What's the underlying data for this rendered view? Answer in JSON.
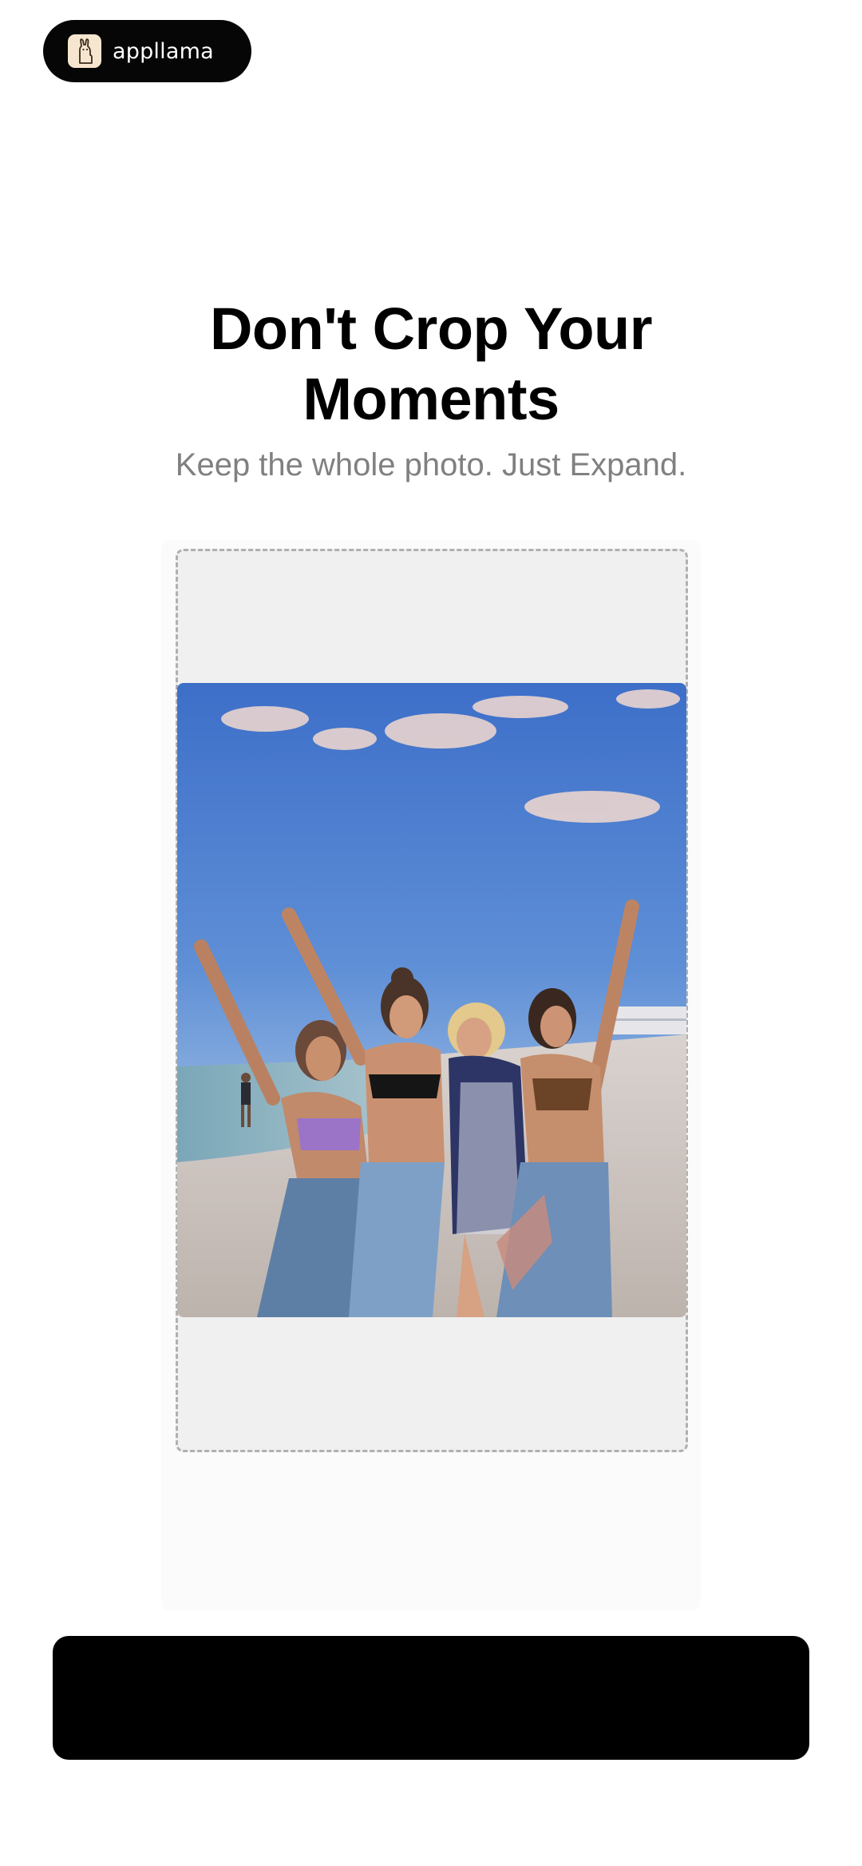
{
  "brand": {
    "name": "appllama",
    "logo_icon": "llama-icon",
    "logo_bg": "#f7e6cf"
  },
  "headline": {
    "line1": "Don't Crop Your",
    "line2": "Moments"
  },
  "subheadline": "Keep the whole photo. Just Expand.",
  "preview": {
    "image_icon": "beach-photo",
    "frame_style": "dashed"
  },
  "primary_button": {
    "label": ""
  },
  "colors": {
    "accent": "#000000",
    "subtle_text": "#808080",
    "frame_fill": "#f0f0f0",
    "frame_border": "#b0b0b0"
  }
}
